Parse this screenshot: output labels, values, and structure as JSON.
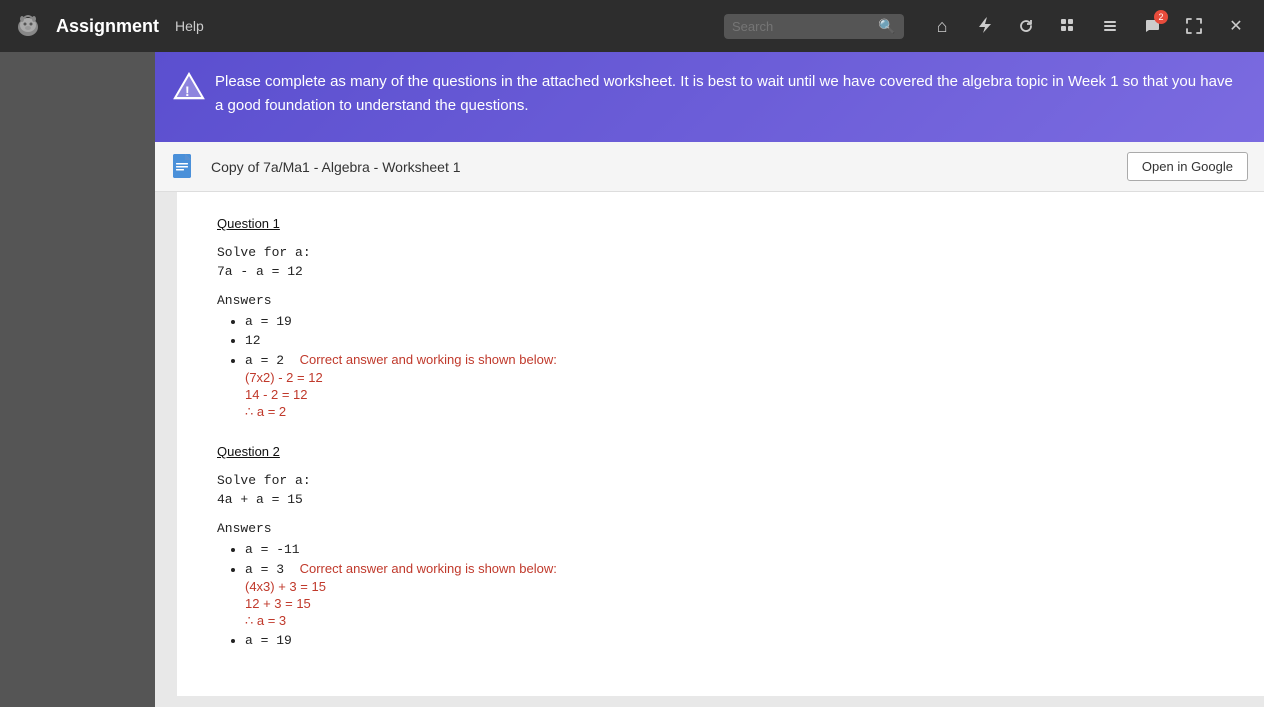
{
  "navbar": {
    "title": "Assignment",
    "help": "Help",
    "search_placeholder": "Search",
    "badge_count": "2",
    "icons": [
      {
        "name": "home-icon",
        "symbol": "⌂"
      },
      {
        "name": "lightning-icon",
        "symbol": "⚡"
      },
      {
        "name": "refresh-icon",
        "symbol": "↺"
      },
      {
        "name": "grid-icon",
        "symbol": "⊞"
      },
      {
        "name": "list-icon",
        "symbol": "≡"
      },
      {
        "name": "chat-icon",
        "symbol": "💬",
        "badge": true
      },
      {
        "name": "expand-icon",
        "symbol": "⤢"
      },
      {
        "name": "close-icon",
        "symbol": "✕"
      }
    ]
  },
  "banner": {
    "text": "Please complete as many of the questions in the attached worksheet. It is best to wait until we have covered the algebra topic in Week 1 so that you have a good foundation to understand the questions."
  },
  "document": {
    "title": "Copy of 7a/Ma1 - Algebra - Worksheet 1",
    "open_button": "Open in Google"
  },
  "worksheet": {
    "questions": [
      {
        "id": "q1",
        "label": "Question 1",
        "solve_label": "Solve for a:",
        "equation": "7a - a = 12",
        "answers_label": "Answers",
        "answers": [
          {
            "value": "a = 19",
            "correct": false,
            "working": null
          },
          {
            "value": "12",
            "correct": false,
            "working": null
          },
          {
            "value": "a = 2",
            "correct": true,
            "correct_label": "Correct answer and working is shown below:",
            "working": [
              "(7x2) - 2 = 12",
              "14 - 2 = 12",
              "∴ a = 2"
            ]
          }
        ]
      },
      {
        "id": "q2",
        "label": "Question 2",
        "solve_label": "Solve for a:",
        "equation": "4a + a = 15",
        "answers_label": "Answers",
        "answers": [
          {
            "value": "a = -11",
            "correct": false,
            "working": null
          },
          {
            "value": "a = 3",
            "correct": true,
            "correct_label": "Correct answer and working is shown below:",
            "working": [
              "(4x3) + 3 = 15",
              "12 + 3 = 15",
              "∴ a = 3"
            ]
          },
          {
            "value": "a = 19",
            "correct": false,
            "working": null
          }
        ]
      }
    ]
  }
}
